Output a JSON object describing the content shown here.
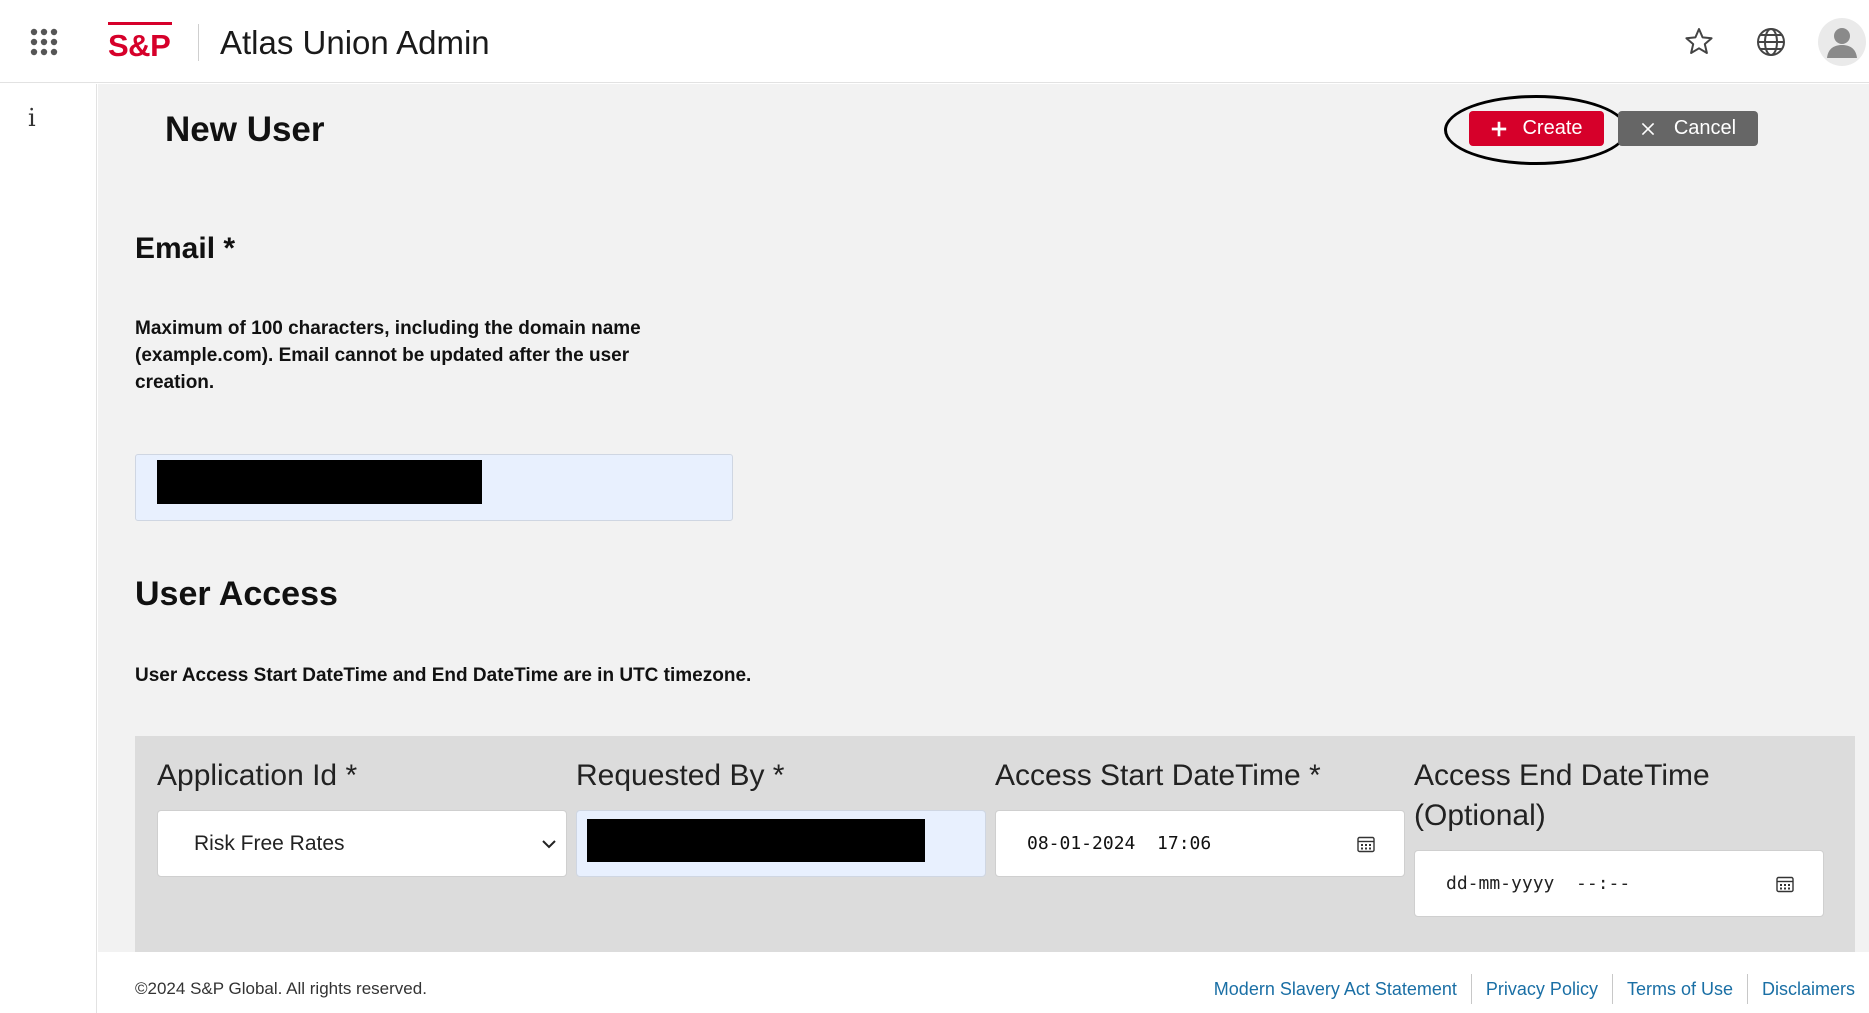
{
  "header": {
    "logo_text": "S&P",
    "app_title": "Atlas Union Admin"
  },
  "left_rail": {
    "info_glyph": "i"
  },
  "page": {
    "title": "New User",
    "create_label": "Create",
    "cancel_label": "Cancel"
  },
  "email": {
    "label": "Email *",
    "help": "Maximum of 100 characters, including the domain name (example.com). Email cannot be updated after the user creation.",
    "value_redacted": true
  },
  "user_access": {
    "title": "User Access",
    "help": "User Access Start DateTime and End DateTime are in UTC timezone.",
    "fields": {
      "application_id": {
        "label": "Application Id *",
        "value": "Risk Free Rates"
      },
      "requested_by": {
        "label": "Requested By *",
        "value_redacted": true
      },
      "access_start": {
        "label": "Access Start DateTime *",
        "value": "08-01-2024  17:06"
      },
      "access_end": {
        "label": "Access End DateTime (Optional)",
        "placeholder": "dd-mm-yyyy  --:--"
      }
    }
  },
  "footer": {
    "copyright": "©2024 S&P Global. All rights reserved.",
    "links": {
      "modern_slavery": "Modern Slavery Act Statement",
      "privacy": "Privacy Policy",
      "terms": "Terms of Use",
      "disclaimers": "Disclaimers"
    }
  },
  "colors": {
    "brand_red": "#d6002a",
    "cancel_gray": "#666666",
    "link_blue": "#1a6fa5",
    "autofill_blue": "#e8f0fe"
  },
  "icons": [
    "apps-grid-icon",
    "star-icon",
    "globe-icon",
    "user-avatar-icon",
    "info-icon",
    "plus-icon",
    "close-icon",
    "chevron-down-icon",
    "calendar-icon"
  ]
}
